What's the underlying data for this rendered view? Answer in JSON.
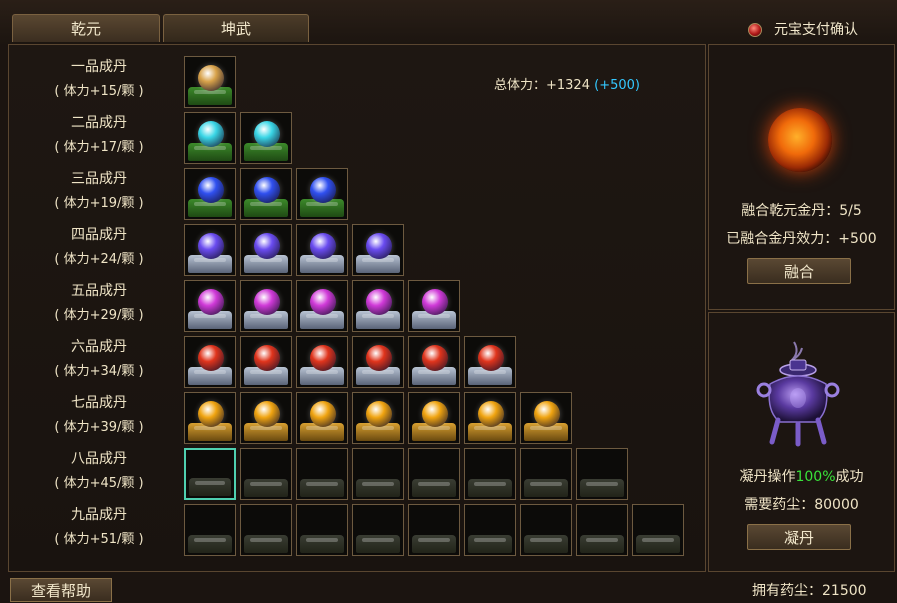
{
  "tabs": [
    {
      "label": "乾元",
      "active": true
    },
    {
      "label": "坤武",
      "active": false
    }
  ],
  "confirm_label": "元宝支付确认",
  "total": {
    "label": "总体力：+1324",
    "plus": "(+500)",
    "close": ")"
  },
  "rows": [
    {
      "name": "一品成丹",
      "stat": "( 体力+15/颗 )",
      "filled": 1,
      "slots": 1,
      "orb": "#d8a24a",
      "base": "green"
    },
    {
      "name": "二品成丹",
      "stat": "( 体力+17/颗 )",
      "filled": 2,
      "slots": 2,
      "orb": "#3ad6e6",
      "base": "green"
    },
    {
      "name": "三品成丹",
      "stat": "( 体力+19/颗 )",
      "filled": 3,
      "slots": 3,
      "orb": "#3050f0",
      "base": "green"
    },
    {
      "name": "四品成丹",
      "stat": "( 体力+24/颗 )",
      "filled": 4,
      "slots": 4,
      "orb": "#6a4cf0",
      "base": "silver"
    },
    {
      "name": "五品成丹",
      "stat": "( 体力+29/颗 )",
      "filled": 5,
      "slots": 5,
      "orb": "#d03ad8",
      "base": "silver"
    },
    {
      "name": "六品成丹",
      "stat": "( 体力+34/颗 )",
      "filled": 6,
      "slots": 6,
      "orb": "#e0341c",
      "base": "silver"
    },
    {
      "name": "七品成丹",
      "stat": "( 体力+39/颗 )",
      "filled": 7,
      "slots": 7,
      "orb": "#f0a410",
      "base": "gold"
    },
    {
      "name": "八品成丹",
      "stat": "( 体力+45/颗 )",
      "filled": 0,
      "slots": 8,
      "orb": "",
      "base": "empty",
      "selected_index": 0
    },
    {
      "name": "九品成丹",
      "stat": "( 体力+51/颗 )",
      "filled": 0,
      "slots": 9,
      "orb": "",
      "base": "empty"
    }
  ],
  "fusion": {
    "count_label": "融合乾元金丹：5/5",
    "effect_label": "已融合金丹效力：+500",
    "button": "融合"
  },
  "condense": {
    "rate_prefix": "凝丹操作",
    "rate_value": "100%",
    "rate_suffix": "成功",
    "cost_label": "需要药尘：80000",
    "button": "凝丹"
  },
  "help_button": "查看帮助",
  "owned_label": "拥有药尘：21500",
  "colors": {
    "accent_plus": "#34c8ff",
    "success_green": "#39e23a",
    "selected_border": "#4fd0b0"
  }
}
